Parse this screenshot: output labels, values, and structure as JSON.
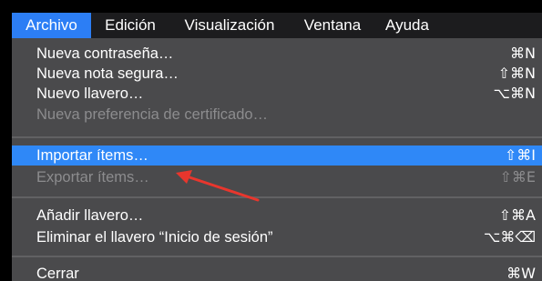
{
  "menubar": {
    "items": [
      {
        "label": "Archivo",
        "active": true
      },
      {
        "label": "Edición",
        "active": false
      },
      {
        "label": "Visualización",
        "active": false
      },
      {
        "label": "Ventana",
        "active": false
      },
      {
        "label": "Ayuda",
        "active": false
      }
    ]
  },
  "menu": {
    "items": [
      {
        "label": "Nueva contraseña…",
        "shortcut": "⌘N",
        "enabled": true,
        "highlighted": false
      },
      {
        "label": "Nueva nota segura…",
        "shortcut": "⇧⌘N",
        "enabled": true,
        "highlighted": false
      },
      {
        "label": "Nuevo llavero…",
        "shortcut": "⌥⌘N",
        "enabled": true,
        "highlighted": false
      },
      {
        "label": "Nueva preferencia de certificado…",
        "shortcut": "",
        "enabled": false,
        "highlighted": false
      },
      {
        "label": "Importar ítems…",
        "shortcut": "⇧⌘I",
        "enabled": true,
        "highlighted": true
      },
      {
        "label": "Exportar ítems…",
        "shortcut": "⇧⌘E",
        "enabled": false,
        "highlighted": false
      },
      {
        "label": "Añadir llavero…",
        "shortcut": "⇧⌘A",
        "enabled": true,
        "highlighted": false
      },
      {
        "label": "Eliminar el llavero “Inicio de sesión”",
        "shortcut": "⌥⌘⌫",
        "enabled": true,
        "highlighted": false
      },
      {
        "label": "Cerrar",
        "shortcut": "⌘W",
        "enabled": true,
        "highlighted": false
      }
    ]
  },
  "colors": {
    "menubar_background": "#1c1c1e",
    "menu_background": "#4a4a4c",
    "highlight": "#2f88f7",
    "disabled_text": "#8c8c8e",
    "annotation_arrow": "#e8362d"
  }
}
